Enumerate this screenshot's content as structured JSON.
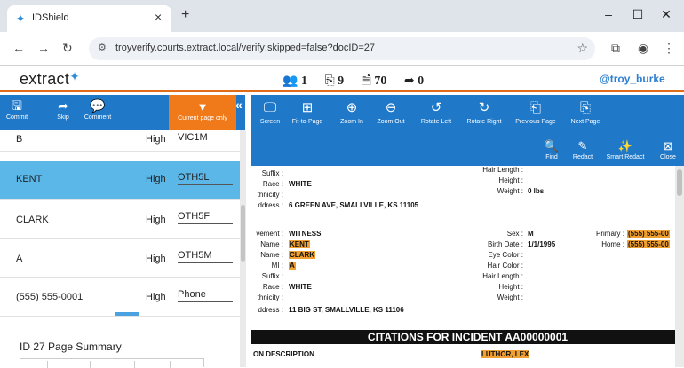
{
  "browser": {
    "tab_title": "IDShield",
    "new_tab": "+",
    "url": "troyverify.courts.extract.local/verify;skipped=false?docID=27"
  },
  "app": {
    "logo": "extract",
    "counts": {
      "people": "1",
      "pages": "9",
      "docs": "70",
      "forward": "0"
    },
    "user": "@troy_burke"
  },
  "left_toolbar": {
    "commit": "Commit",
    "skip": "Skip",
    "comment": "Comment",
    "filter": "Current page only"
  },
  "rows": [
    {
      "name": "B",
      "confidence": "High",
      "code": "VIC1M"
    },
    {
      "name": "KENT",
      "confidence": "High",
      "code": "OTH5L"
    },
    {
      "name": "CLARK",
      "confidence": "High",
      "code": "OTH5F"
    },
    {
      "name": "A",
      "confidence": "High",
      "code": "OTH5M"
    },
    {
      "name": "(555) 555-0001",
      "confidence": "High",
      "code": "Phone"
    }
  ],
  "summary": "ID 27 Page Summary",
  "viewer_toolbar": {
    "screen": "Screen",
    "fit": "Fit-to-Page",
    "zoom_in": "Zoom In",
    "zoom_out": "Zoom Out",
    "rotate_left": "Rotate Left",
    "rotate_right": "Rotate Right",
    "prev_page": "Previous Page",
    "next_page": "Next Page",
    "find": "Find",
    "redact": "Redact",
    "smart_redact": "Smart Redact",
    "close": "Close"
  },
  "document": {
    "p1": {
      "suffix": "Suffix :",
      "race": "Race :",
      "race_val": "WHITE",
      "ethnicity": "thnicity :",
      "address": "ddress :",
      "address_val": "6 GREEN AVE, SMALLVILLE, KS 11105",
      "hair_length": "Hair Length :",
      "height": "Height :",
      "weight": "Weight :",
      "weight_val": "0 lbs"
    },
    "p2": {
      "involvement": "vement :",
      "involvement_val": "WITNESS",
      "name1": "Name :",
      "name1_val": "KENT",
      "name2": "Name :",
      "name2_val": "CLARK",
      "mi": "MI :",
      "mi_val": "A",
      "suffix": "Suffix :",
      "race": "Race :",
      "race_val": "WHITE",
      "ethnicity": "thnicity :",
      "address": "ddress :",
      "address_val": "11 BIG ST, SMALLVILLE, KS 11106",
      "sex": "Sex :",
      "sex_val": "M",
      "birth": "Birth Date :",
      "birth_val": "1/1/1995",
      "eye": "Eye Color :",
      "hair": "Hair Color :",
      "hair_length": "Hair Length :",
      "height": "Height :",
      "weight": "Weight :",
      "primary": "Primary :",
      "primary_val": "(555) 555-00",
      "home": "Home :",
      "home_val": "(555) 555-00"
    },
    "citations_title": "CITATIONS FOR INCIDENT AA00000001",
    "col_desc": "ON DESCRIPTION",
    "col_hl": "LUTHOR, LEX"
  }
}
